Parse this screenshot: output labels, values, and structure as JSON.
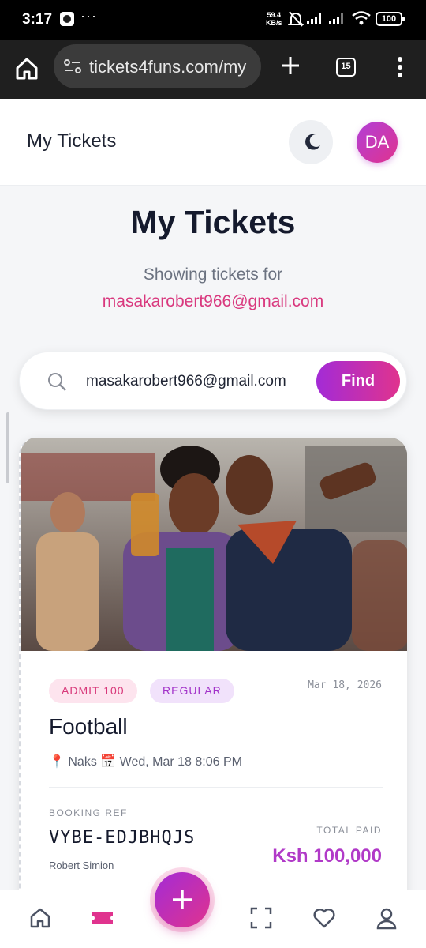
{
  "status_bar": {
    "time": "3:17",
    "network_speed_value": "59.4",
    "network_speed_unit": "KB/s",
    "battery": "100"
  },
  "browser": {
    "url": "tickets4funs.com/my",
    "tab_count": "15"
  },
  "app_header": {
    "title": "My Tickets",
    "avatar_initials": "DA"
  },
  "page": {
    "title": "My Tickets",
    "subtitle": "Showing tickets for",
    "email": "masakarobert966@gmail.com"
  },
  "search": {
    "value": "masakarobert966@gmail.com",
    "button_label": "Find"
  },
  "ticket": {
    "admit_badge": "ADMIT 100",
    "type_badge": "REGULAR",
    "date": "Mar 18, 2026",
    "event_name": "Football",
    "venue": "Naks",
    "datetime": "Wed, Mar 18 8:06 PM",
    "booking_ref_label": "BOOKING REF",
    "booking_ref": "VYBE-EDJBHQJS",
    "holder": "Robert Simion",
    "total_paid_label": "TOTAL PAID",
    "total_paid": "Ksh 100,000"
  },
  "colors": {
    "accent_pink": "#e0338e",
    "accent_purple": "#a32bd6",
    "price_color": "#b13ac8"
  },
  "bottom_nav": {
    "items": [
      "home-icon",
      "ticket-icon",
      "add-icon",
      "scan-icon",
      "heart-icon",
      "profile-icon"
    ],
    "active": "ticket-icon"
  }
}
